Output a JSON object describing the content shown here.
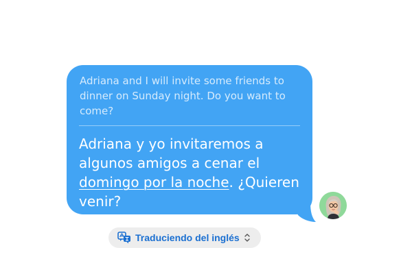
{
  "message": {
    "original_text": "Adriana and I will invite some friends to dinner on Sunday night. Do you want to come?",
    "translated_before_link": "Adriana y yo invitaremos a algunos amigos a cenar el ",
    "translated_link": "domingo por la noche",
    "translated_after_link": ". ¿Quieren venir?",
    "bubble_color": "#42a4f4"
  },
  "translation_status": {
    "label": "Traduciendo del inglés",
    "icon": "translate-icon",
    "chevron_icon": "chevron-up-down-icon",
    "accent_color": "#1a6fd1"
  },
  "sender": {
    "avatar_icon": "memoji-avatar",
    "avatar_bg": "#8fd99a"
  }
}
